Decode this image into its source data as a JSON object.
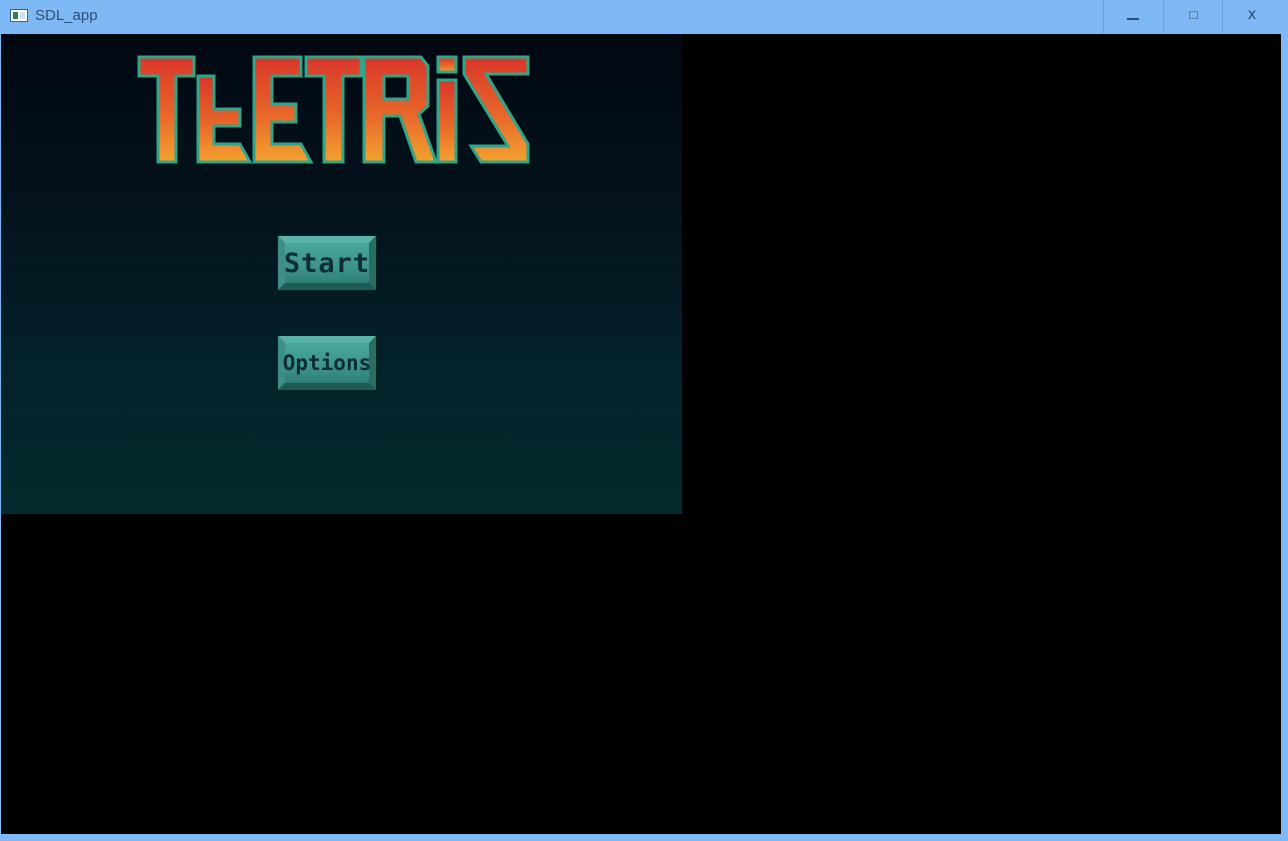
{
  "window": {
    "title": "SDL_app",
    "icon": "app-window-icon",
    "controls": {
      "minimize_icon": "minimize-icon",
      "maximize_icon": "maximize-icon",
      "close_label": "x"
    }
  },
  "game": {
    "logo_text": "TEETRIS",
    "menu": {
      "start_label": "Start",
      "options_label": "Options"
    }
  },
  "colors": {
    "titlebar": "#7fb9f5",
    "logo_top": "#d9362a",
    "logo_bottom": "#f09a2c",
    "logo_outline": "#2fa58a",
    "button_face": "#3d968c",
    "background_top": "#020812",
    "background_bottom": "#042b2d"
  }
}
